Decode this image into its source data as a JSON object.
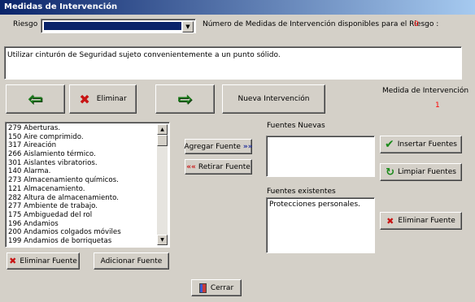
{
  "window": {
    "title": "Medidas de Intervención"
  },
  "riesgo": {
    "label": "Riesgo",
    "count_label": "Número de Medidas de Intervención disponibles para el Riesgo :",
    "count_value": "0"
  },
  "description": {
    "text": "Utilizar cinturón de Seguridad sujeto convenientemente a un punto sólido."
  },
  "toolbar": {
    "eliminar_label": "Eliminar",
    "nueva_label": "Nueva Intervención"
  },
  "medida": {
    "label": "Medida de Intervención",
    "value": "1"
  },
  "fuentes_list": {
    "items": [
      "279 Aberturas.",
      "150 Aire comprimido.",
      "317 Aireación",
      "266 Aislamiento térmico.",
      "301 Aislantes vibratorios.",
      "140 Alarma.",
      "273 Almacenamiento químicos.",
      "121 Almacenamiento.",
      "282 Altura de almacenamiento.",
      "277 Ambiente de trabajo.",
      "175 Ambiguedad del rol",
      "196 Andamios",
      "200 Andamios colgados móviles",
      "199 Andamios de borriquetas"
    ]
  },
  "buttons": {
    "agregar": "Agregar Fuente",
    "retirar": "Retirar Fuente",
    "eliminar_fuente": "Eliminar Fuente",
    "adicionar_fuente": "Adicionar Fuente",
    "insertar": "Insertar Fuentes",
    "limpiar": "Limpiar Fuentes",
    "eliminar_fuente2": "Eliminar Fuente",
    "cerrar": "Cerrar"
  },
  "fuentes_nuevas": {
    "label": "Fuentes Nuevas"
  },
  "fuentes_existentes": {
    "label": "Fuentes existentes",
    "items": [
      "Protecciones personales."
    ]
  },
  "colors": {
    "title_start": "#0a246a",
    "title_end": "#a6caf0",
    "count_red": "#ff0000"
  },
  "icons": [
    "back-arrow-icon",
    "delete-x-icon",
    "forward-arrow-icon",
    "double-chevron-right-icon",
    "double-chevron-left-icon",
    "checkmark-icon",
    "refresh-icon",
    "close-door-icon"
  ]
}
